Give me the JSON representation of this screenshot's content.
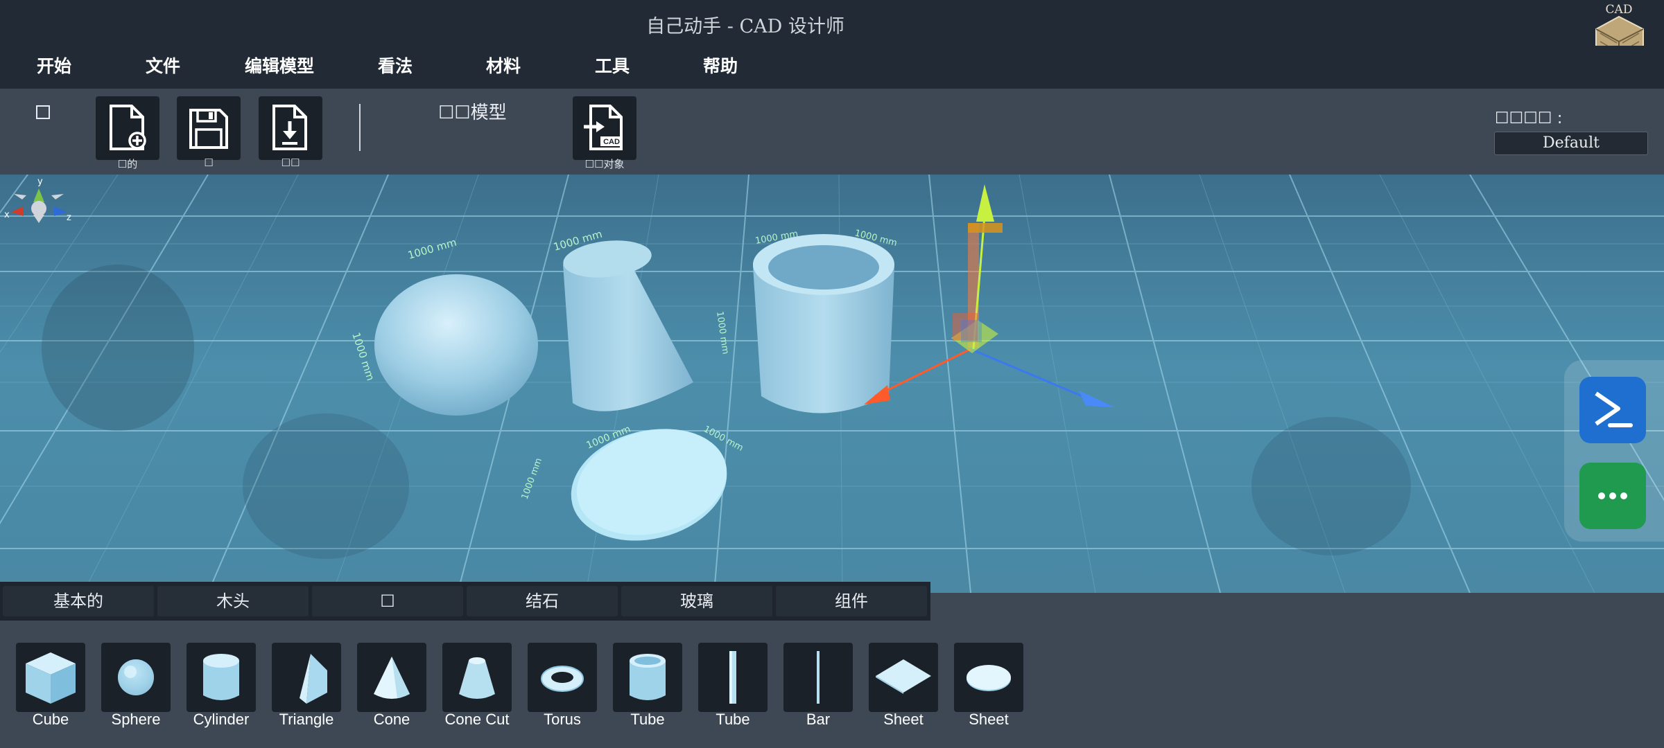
{
  "app": {
    "title": "自己动手 - CAD 设计师",
    "logo_text": "CAD"
  },
  "menu": {
    "items": [
      {
        "label": "开始"
      },
      {
        "label": "文件"
      },
      {
        "label": "编辑模型"
      },
      {
        "label": "看法"
      },
      {
        "label": "材料"
      },
      {
        "label": "工具"
      },
      {
        "label": "帮助"
      }
    ]
  },
  "toolbar": {
    "checkbox_label": "☐",
    "new_caption": "☐的",
    "save_caption": "☐",
    "download_caption": "☐☐",
    "model_label": "☐☐模型",
    "export_caption": "☐☐对象",
    "export_icon_text": "CAD",
    "theme_label": "☐☐☐☐ :",
    "theme_value": "Default"
  },
  "viewport": {
    "dimension_label": "1000 mm",
    "axis_labels": {
      "x": "x",
      "y": "y",
      "z": "z"
    }
  },
  "categories": {
    "tabs": [
      {
        "label": "基本的"
      },
      {
        "label": "木头"
      },
      {
        "label": "☐"
      },
      {
        "label": "结石"
      },
      {
        "label": "玻璃"
      },
      {
        "label": "组件"
      }
    ]
  },
  "primitives": {
    "items": [
      {
        "label": "Cube",
        "icon": "cube-icon"
      },
      {
        "label": "Sphere",
        "icon": "sphere-icon"
      },
      {
        "label": "Cylinder",
        "icon": "cylinder-icon"
      },
      {
        "label": "Triangle",
        "icon": "triangle-prism-icon"
      },
      {
        "label": "Cone",
        "icon": "cone-icon"
      },
      {
        "label": "Cone Cut",
        "icon": "cone-cut-icon"
      },
      {
        "label": "Torus",
        "icon": "torus-icon"
      },
      {
        "label": "Tube",
        "icon": "tube-icon"
      },
      {
        "label": "Tube",
        "icon": "thin-tube-icon"
      },
      {
        "label": "Bar",
        "icon": "bar-icon"
      },
      {
        "label": "Sheet",
        "icon": "sheet-icon"
      },
      {
        "label": "Sheet",
        "icon": "round-sheet-icon"
      }
    ]
  },
  "colors": {
    "object_fill": "#8fc5e0",
    "accent_blue": "#1e6fd0",
    "accent_green": "#1f9a4e",
    "gizmo_x": "#ff5a2a",
    "gizmo_y": "#c8f040",
    "gizmo_z": "#3c78f0"
  }
}
